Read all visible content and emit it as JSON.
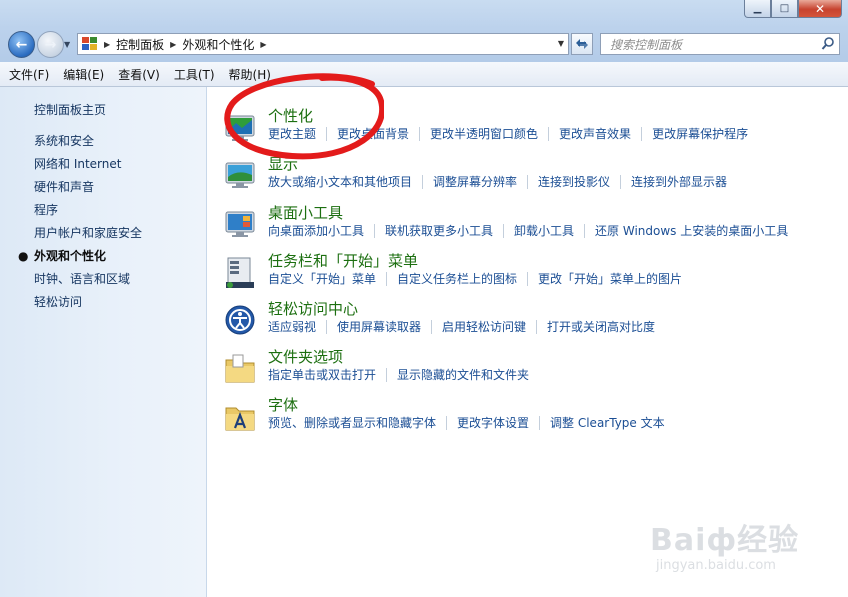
{
  "window": {
    "minimize_glyph": "▁",
    "maximize_glyph": "□",
    "close_glyph": "✕"
  },
  "nav": {
    "back_glyph": "←",
    "forward_glyph": "→"
  },
  "address": {
    "crumbs": [
      "控制面板",
      "外观和个性化"
    ]
  },
  "search": {
    "placeholder": "搜索控制面板"
  },
  "menu": [
    "文件(F)",
    "编辑(E)",
    "查看(V)",
    "工具(T)",
    "帮助(H)"
  ],
  "sidebar": {
    "home": "控制面板主页",
    "items": [
      {
        "label": "系统和安全",
        "active": false
      },
      {
        "label": "网络和 Internet",
        "active": false
      },
      {
        "label": "硬件和声音",
        "active": false
      },
      {
        "label": "程序",
        "active": false
      },
      {
        "label": "用户帐户和家庭安全",
        "active": false
      },
      {
        "label": "外观和个性化",
        "active": true
      },
      {
        "label": "时钟、语言和区域",
        "active": false
      },
      {
        "label": "轻松访问",
        "active": false
      }
    ]
  },
  "categories": [
    {
      "title": "个性化",
      "icon": "personalization-icon",
      "links": [
        "更改主题",
        "更改桌面背景",
        "更改半透明窗口颜色",
        "更改声音效果",
        "更改屏幕保护程序"
      ]
    },
    {
      "title": "显示",
      "icon": "display-icon",
      "links": [
        "放大或缩小文本和其他项目",
        "调整屏幕分辨率",
        "连接到投影仪",
        "连接到外部显示器"
      ]
    },
    {
      "title": "桌面小工具",
      "icon": "gadgets-icon",
      "links": [
        "向桌面添加小工具",
        "联机获取更多小工具",
        "卸载小工具",
        "还原 Windows 上安装的桌面小工具"
      ]
    },
    {
      "title": "任务栏和「开始」菜单",
      "icon": "taskbar-icon",
      "links": [
        "自定义「开始」菜单",
        "自定义任务栏上的图标",
        "更改「开始」菜单上的图片"
      ]
    },
    {
      "title": "轻松访问中心",
      "icon": "ease-of-access-icon",
      "links": [
        "适应弱视",
        "使用屏幕读取器",
        "启用轻松访问键",
        "打开或关闭高对比度"
      ]
    },
    {
      "title": "文件夹选项",
      "icon": "folder-options-icon",
      "links": [
        "指定单击或双击打开",
        "显示隐藏的文件和文件夹"
      ]
    },
    {
      "title": "字体",
      "icon": "fonts-icon",
      "links": [
        "预览、删除或者显示和隐藏字体",
        "更改字体设置",
        "调整 ClearType 文本"
      ]
    }
  ],
  "watermark": {
    "text": "Baiф经验",
    "sub": "jingyan.baidu.com"
  },
  "colors": {
    "category_title": "#1c6f10",
    "link": "#1b4e94",
    "annotation": "#e31b1b"
  }
}
